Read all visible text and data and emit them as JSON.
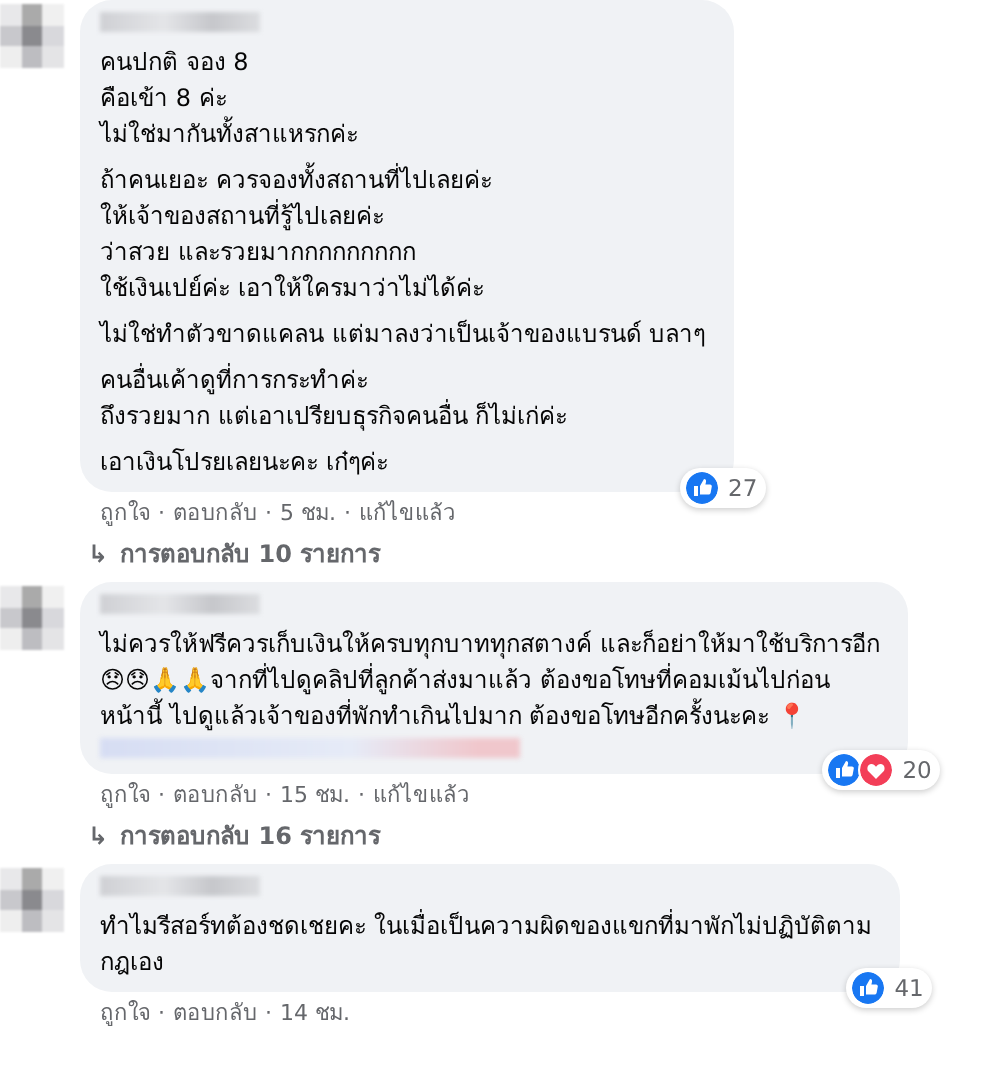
{
  "comments": [
    {
      "paragraphs": [
        [
          "คนปกติ จอง 8",
          "คือเข้า 8 ค่ะ",
          "ไม่ใช่มากันทั้งสาแหรกค่ะ"
        ],
        [
          "ถ้าคนเยอะ ควรจองทั้งสถานที่ไปเลยค่ะ",
          "ให้เจ้าของสถานที่รู้ไปเลยค่ะ",
          "ว่าสวย และรวยมากกกกกกกกก",
          "ใช้เงินเปย์ค่ะ เอาให้ใครมาว่าไม่ได้ค่ะ"
        ],
        [
          "ไม่ใช่ทำตัวขาดแคลน แต่มาลงว่าเป็นเจ้าของแบรนด์ บลาๆ"
        ],
        [
          "คนอื่นเค้าดูที่การกระทำค่ะ",
          "ถึงรวยมาก แต่เอาเปรียบธุรกิจคนอื่น ก็ไม่เก่ค่ะ"
        ],
        [
          "เอาเงินโปรยเลยนะคะ เก๋ๆค่ะ"
        ]
      ],
      "blurred_tag": false,
      "reactions": [
        {
          "kind": "like"
        }
      ],
      "reaction_count": "27",
      "actions": [
        "ถูกใจ",
        "ตอบกลับ",
        "5 ชม.",
        "แก้ไขแล้ว"
      ],
      "replies": {
        "arrow": "↳",
        "label": "การตอบกลับ 10 รายการ"
      }
    },
    {
      "paragraphs": [
        [
          "ไม่ควรให้ฟรีควรเก็บเงินให้ครบทุกบาททุกสตางค์ และก็อย่าให้มาใช้บริการอีก",
          "😞😞🙏🙏จากที่ไปดูคลิปที่ลูกค้าส่งมาแล้ว ต้องขอโทษที่คอมเม้นไปก่อน",
          "หน้านี้ ไปดูแล้วเจ้าของที่พักทำเกินไปมาก ต้องขอโทษอีกครั้งนะคะ 📍"
        ]
      ],
      "blurred_tag": true,
      "reactions": [
        {
          "kind": "like"
        },
        {
          "kind": "love"
        }
      ],
      "reaction_count": "20",
      "actions": [
        "ถูกใจ",
        "ตอบกลับ",
        "15 ชม.",
        "แก้ไขแล้ว"
      ],
      "replies": {
        "arrow": "↳",
        "label": "การตอบกลับ 16 รายการ"
      }
    },
    {
      "paragraphs": [
        [
          "ทำไมรีสอร์ทต้องชดเชยคะ ในเมื่อเป็นความผิดของแขกที่มาพักไม่ปฏิบัติตาม",
          "กฎเอง"
        ]
      ],
      "blurred_tag": false,
      "reactions": [
        {
          "kind": "like"
        }
      ],
      "reaction_count": "41",
      "actions": [
        "ถูกใจ",
        "ตอบกลับ",
        "14 ชม."
      ]
    }
  ],
  "separator": "·"
}
